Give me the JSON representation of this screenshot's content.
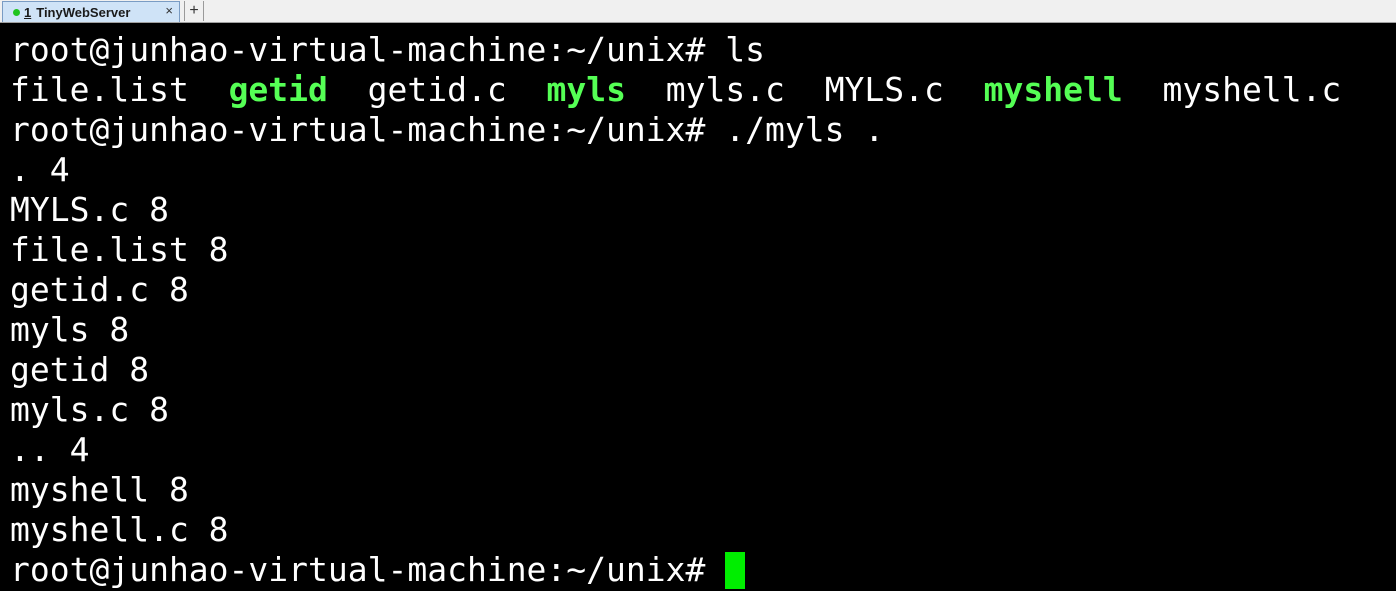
{
  "tabbar": {
    "tab": {
      "number": "1",
      "title": "TinyWebServer",
      "close_glyph": "×"
    },
    "add_glyph": "+"
  },
  "terminal": {
    "prompt": "root@junhao-virtual-machine:~/unix#",
    "cmd1": " ls",
    "ls_output": [
      {
        "name": "file.list",
        "exec": false
      },
      {
        "name": "getid",
        "exec": true
      },
      {
        "name": "getid.c",
        "exec": false
      },
      {
        "name": "myls",
        "exec": true
      },
      {
        "name": "myls.c",
        "exec": false
      },
      {
        "name": "MYLS.c",
        "exec": false
      },
      {
        "name": "myshell",
        "exec": true
      },
      {
        "name": "myshell.c",
        "exec": false
      }
    ],
    "ls_sep": "  ",
    "cmd2": " ./myls .",
    "myls_output": [
      ". 4",
      "MYLS.c 8",
      "file.list 8",
      "getid.c 8",
      "myls 8",
      "getid 8",
      "myls.c 8",
      ".. 4",
      "myshell 8",
      "myshell.c 8"
    ],
    "colors": {
      "exec": "#55ff55",
      "cursor": "#00ee00"
    }
  }
}
